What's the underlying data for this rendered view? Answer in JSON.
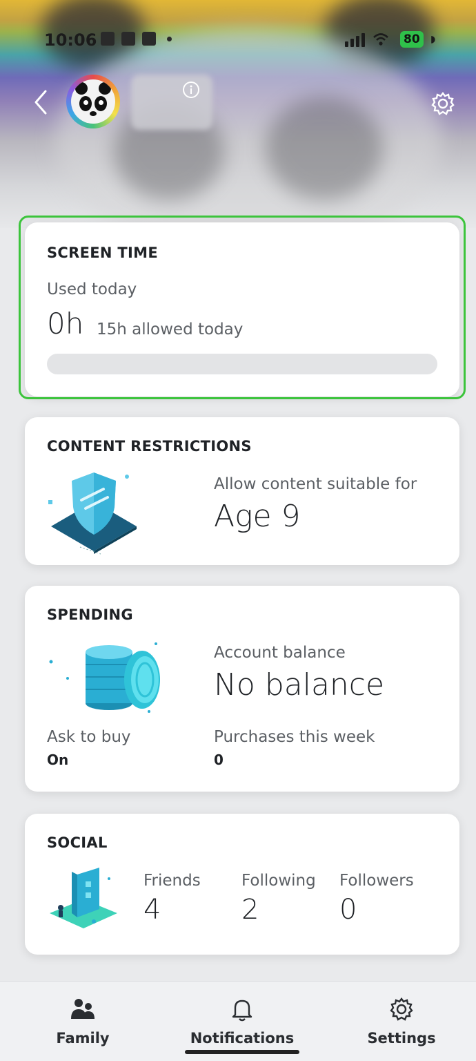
{
  "status_bar": {
    "time": "10:06",
    "battery": "80"
  },
  "header": {
    "back_icon": "chevron-left-icon",
    "info_icon": "info-icon",
    "settings_icon": "gear-icon"
  },
  "screen_time": {
    "title": "SCREEN TIME",
    "used_label": "Used today",
    "used_value": "0h",
    "allowed": "15h allowed today",
    "progress_fraction": 0,
    "highlight_color": "#3cc43c"
  },
  "content_restrictions": {
    "title": "CONTENT RESTRICTIONS",
    "label": "Allow content suitable for",
    "value": "Age 9"
  },
  "spending": {
    "title": "SPENDING",
    "balance_label": "Account balance",
    "balance_value": "No balance",
    "ask_label": "Ask to buy",
    "ask_value": "On",
    "purchases_label": "Purchases this week",
    "purchases_value": "0"
  },
  "social": {
    "title": "SOCIAL",
    "stats": [
      {
        "label": "Friends",
        "value": "4"
      },
      {
        "label": "Following",
        "value": "2"
      },
      {
        "label": "Followers",
        "value": "0"
      }
    ]
  },
  "bottom_nav": {
    "items": [
      {
        "label": "Family",
        "icon": "family-icon"
      },
      {
        "label": "Notifications",
        "icon": "bell-icon"
      },
      {
        "label": "Settings",
        "icon": "gear-icon"
      }
    ]
  },
  "colors": {
    "accent": "#2a9fd6",
    "card_bg": "#ffffff",
    "page_bg": "#e9eaec"
  }
}
